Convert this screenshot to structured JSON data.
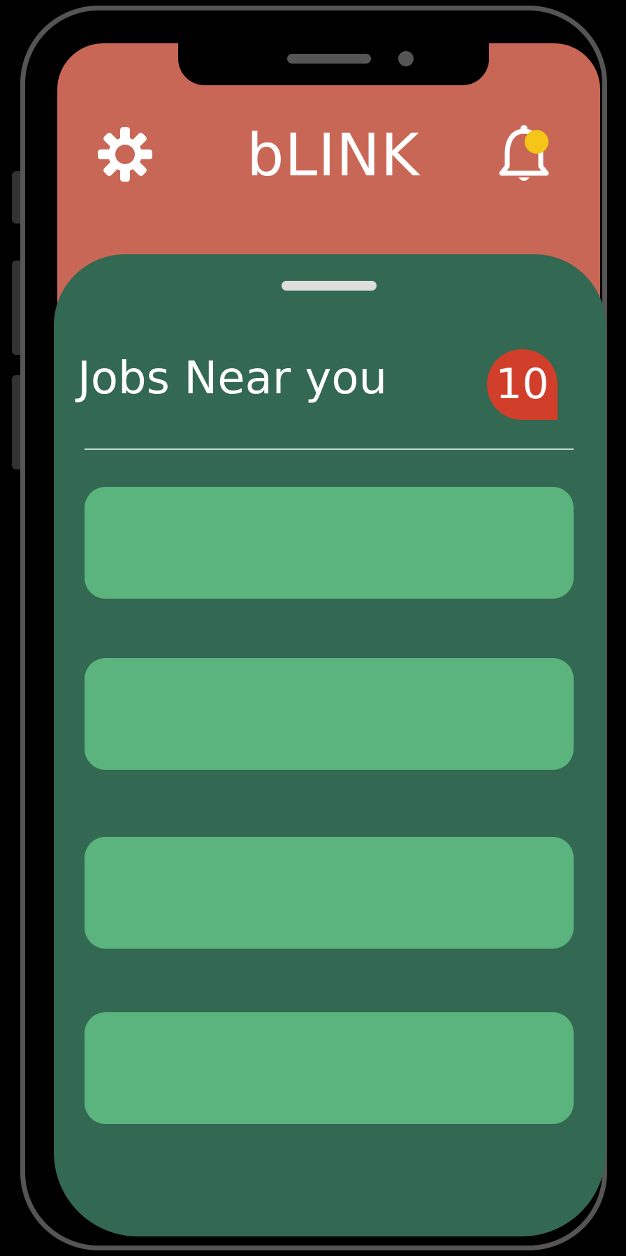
{
  "app": {
    "title": "bLINK"
  },
  "header": {
    "settings_icon": "gear-icon",
    "notifications_icon": "bell-icon",
    "has_unread_notifications": true
  },
  "jobs_section": {
    "title": "Jobs Near you",
    "count": "10",
    "cards": [
      {},
      {},
      {},
      {}
    ]
  },
  "colors": {
    "header": "#c96756",
    "sheet": "#336852",
    "card": "#5bb37d",
    "badge": "#d13e2a",
    "notification_dot": "#f5c518"
  }
}
